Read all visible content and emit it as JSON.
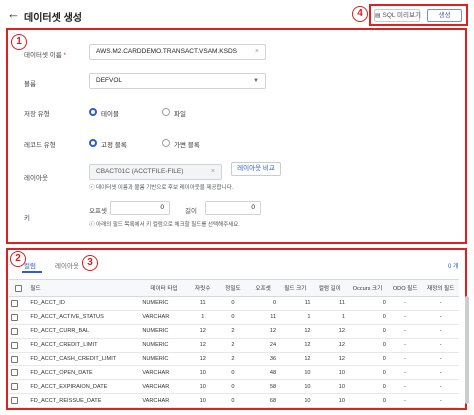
{
  "header": {
    "back_icon": "arrow-left-icon",
    "title": "데이터셋 생성",
    "sql_preview_label": "SQL 미리보기",
    "save_label": "생성"
  },
  "annotations": [
    "1",
    "2",
    "3",
    "4"
  ],
  "form": {
    "dataset_name_label": "데이터셋 이름",
    "required_mark": "*",
    "dataset_name_value": "AWS.M2.CARDDEMO.TRANSACT.VSAM.KSDS",
    "clear_icon": "×",
    "volume_label": "볼륨",
    "volume_value": "DEFVOL",
    "storage_type_label": "저장 유형",
    "storage_options": [
      "테이블",
      "파일"
    ],
    "storage_selected": "테이블",
    "record_type_label": "레코드 유형",
    "record_options": [
      "고정 블록",
      "가변 블록"
    ],
    "record_selected": "고정 블록",
    "layout_label": "레이아웃",
    "layout_value": "CBACT01C (ACCTFILE-FILE)",
    "layout_compare_label": "레이아웃 비교",
    "layout_hint": "ⓘ 데이터셋 이름과 볼륨 기반으로 후보 레이아웃을 제공합니다.",
    "key_label": "키",
    "offset_label": "오프셋",
    "offset_value": "0",
    "length_label": "길이",
    "length_value": "0",
    "key_hint": "ⓘ 아래의 필드 목록에서 키 컬럼으로 체크할 필드를 선택해주세요."
  },
  "tabs": [
    "컬럼",
    "레이아웃"
  ],
  "active_tab": "컬럼",
  "count_label": "0 개",
  "table": {
    "columns": [
      "필드",
      "데이터 타입",
      "자릿수",
      "정밀도",
      "오프셋",
      "필드 크기",
      "컬럼 길이",
      "Occurs 크기",
      "ODO 필드",
      "재정의 필드"
    ],
    "rows": [
      [
        "FD_ACCT_ID",
        "NUMERIC",
        "11",
        "0",
        "0",
        "11",
        "11",
        "0",
        "-",
        "-"
      ],
      [
        "FD_ACCT_ACTIVE_STATUS",
        "VARCHAR",
        "1",
        "0",
        "11",
        "1",
        "1",
        "0",
        "-",
        "-"
      ],
      [
        "FD_ACCT_CURR_BAL",
        "NUMERIC",
        "12",
        "2",
        "12",
        "12",
        "12",
        "0",
        "-",
        "-"
      ],
      [
        "FD_ACCT_CREDIT_LIMIT",
        "NUMERIC",
        "12",
        "2",
        "24",
        "12",
        "12",
        "0",
        "-",
        "-"
      ],
      [
        "FD_ACCT_CASH_CREDIT_LIMIT",
        "NUMERIC",
        "12",
        "2",
        "36",
        "12",
        "12",
        "0",
        "-",
        "-"
      ],
      [
        "FD_ACCT_OPEN_DATE",
        "VARCHAR",
        "10",
        "0",
        "48",
        "10",
        "10",
        "0",
        "-",
        "-"
      ],
      [
        "FD_ACCT_EXPIRAION_DATE",
        "VARCHAR",
        "10",
        "0",
        "58",
        "10",
        "10",
        "0",
        "-",
        "-"
      ],
      [
        "FD_ACCT_REISSUE_DATE",
        "VARCHAR",
        "10",
        "0",
        "68",
        "10",
        "10",
        "0",
        "-",
        "-"
      ]
    ]
  },
  "colors": {
    "accent": "#2f5bd3",
    "annotation": "#e01f1f"
  }
}
